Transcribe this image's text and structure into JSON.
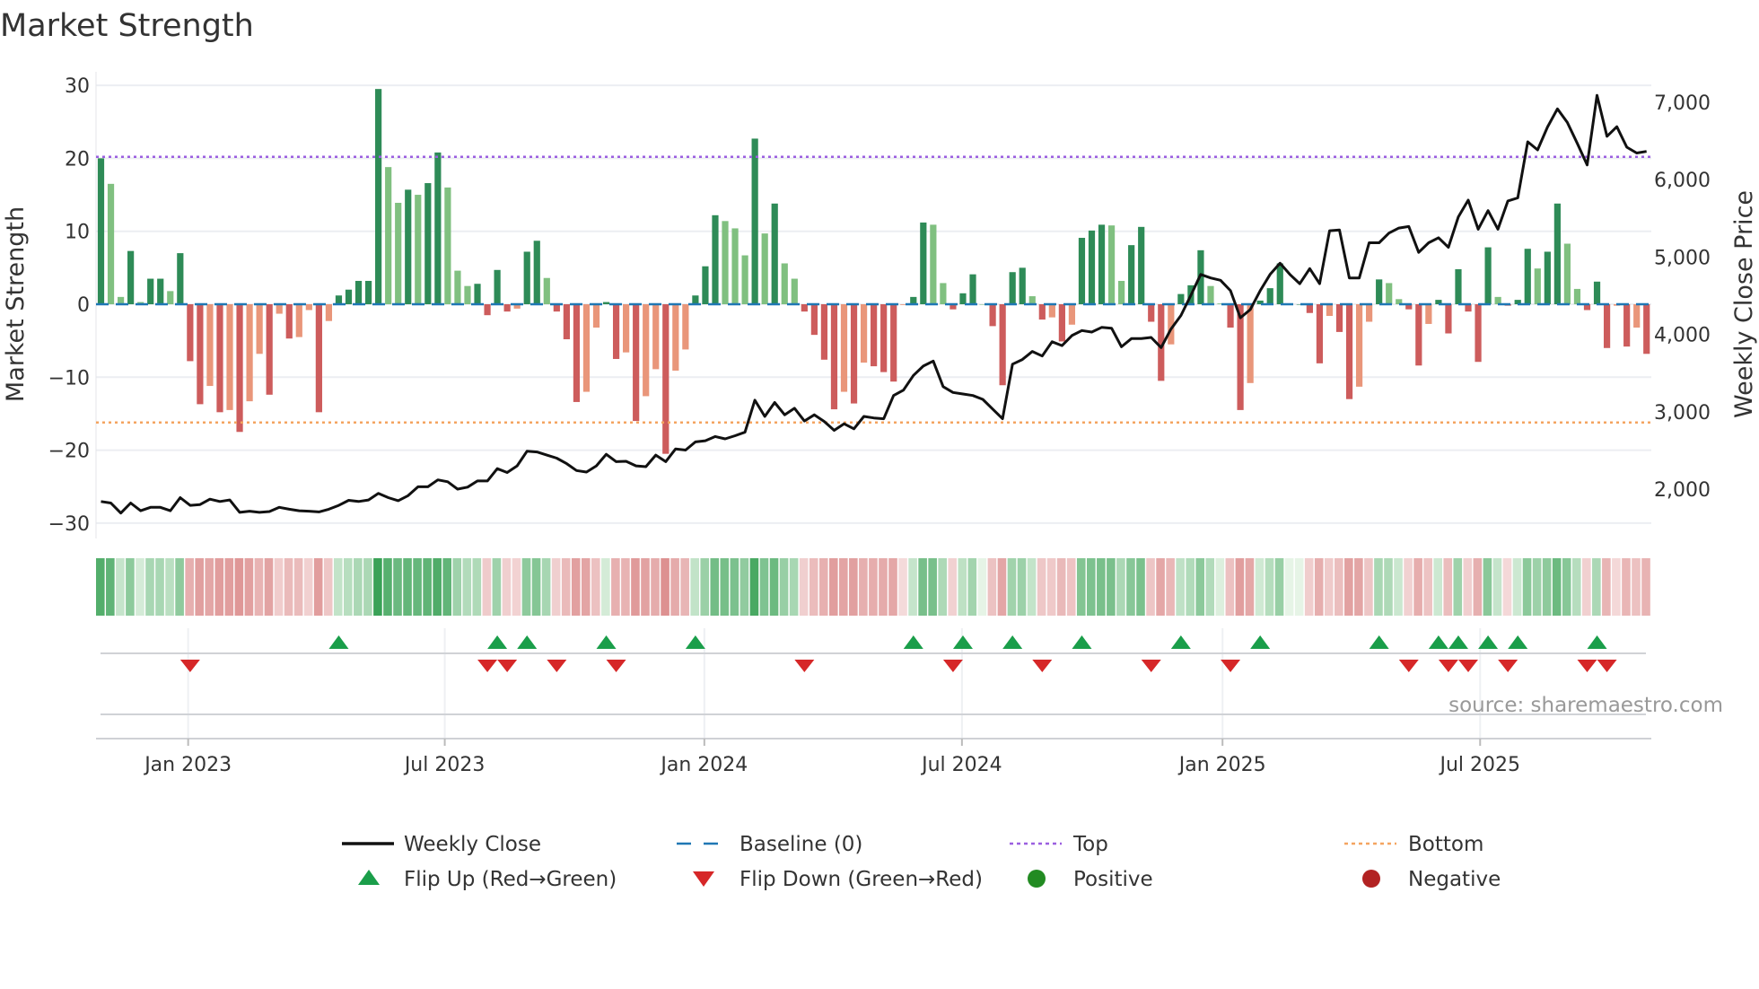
{
  "chart_data": {
    "type": "bar",
    "title": "Market Strength",
    "ylabel": "Market Strength",
    "y2label": "Weekly Close Price",
    "ylim": [
      -31,
      32
    ],
    "y2lim": [
      1500,
      7200
    ],
    "yticks": [
      30,
      20,
      10,
      0,
      -10,
      -20,
      -30
    ],
    "ytick_labels": [
      "30",
      "20",
      "10",
      "0",
      "−10",
      "−20",
      "−30"
    ],
    "y2ticks": [
      7000,
      6000,
      5000,
      4000,
      3000,
      2000
    ],
    "y2tick_labels": [
      "7,000",
      "6,000",
      "5,000",
      "4,000",
      "3,000",
      "2,000"
    ],
    "x_unit": "week index",
    "xticks": [
      {
        "label": "Jan 2023",
        "week": 8.8
      },
      {
        "label": "Jul 2023",
        "week": 34.7
      },
      {
        "label": "Jan 2024",
        "week": 60.9
      },
      {
        "label": "Jul 2024",
        "week": 86.9
      },
      {
        "label": "Jan 2025",
        "week": 113.2
      },
      {
        "label": "Jul 2025",
        "week": 139.2
      }
    ],
    "top_level": 20.2,
    "bottom_level": -16.2,
    "strength": [
      20,
      16.5,
      1,
      7.3,
      0.3,
      3.5,
      3.5,
      1.8,
      7,
      -7.8,
      -13.7,
      -11.2,
      -14.8,
      -14.5,
      -17.5,
      -13.3,
      -6.8,
      -12.4,
      -1.3,
      -4.7,
      -4.5,
      -0.8,
      -14.8,
      -2.3,
      1.2,
      2,
      3.2,
      3.2,
      29.5,
      18.8,
      13.9,
      15.7,
      15,
      16.6,
      20.8,
      16,
      4.6,
      2.5,
      2.8,
      -1.5,
      4.7,
      -1,
      -0.6,
      7.2,
      8.7,
      3.6,
      -1,
      -4.8,
      -13.4,
      -12,
      -3.2,
      0.3,
      -7.5,
      -6.6,
      -16,
      -12.6,
      -8.9,
      -20.5,
      -9.1,
      -6.2,
      1.2,
      5.2,
      12.2,
      11.4,
      10.4,
      6.7,
      22.7,
      9.7,
      13.8,
      5.6,
      3.5,
      -1,
      -4.2,
      -7.6,
      -14.4,
      -12,
      -13.6,
      -8,
      -8.5,
      -9.3,
      -10.6,
      -0.1,
      1,
      11.2,
      10.9,
      2.9,
      -0.7,
      1.5,
      4.1,
      0,
      -3,
      -11.1,
      4.4,
      5,
      1.1,
      -2.1,
      -1.8,
      -5.1,
      -2.8,
      9.1,
      10.1,
      10.9,
      10.8,
      3.2,
      8.1,
      10.6,
      -2.4,
      -10.5,
      -5.5,
      1.4,
      2.6,
      7.4,
      2.5,
      0.1,
      -3.2,
      -14.5,
      -10.8,
      0.5,
      2.2,
      5.6,
      0,
      0,
      -1.2,
      -8.1,
      -1.6,
      -3.8,
      -13,
      -11.3,
      -2.4,
      3.4,
      2.9,
      0.7,
      -0.7,
      -8.4,
      -2.7,
      0.6,
      -4,
      4.8,
      -1,
      -7.9,
      7.8,
      1,
      -0.2,
      0.6,
      7.6,
      4.9,
      7.2,
      13.8,
      8.3,
      2.1,
      -0.8,
      3.1,
      -6,
      -0.2,
      -5.8,
      -3.2,
      -6.8
    ],
    "weekly_close": [
      1840,
      1820,
      1690,
      1820,
      1720,
      1765,
      1765,
      1720,
      1890,
      1790,
      1800,
      1870,
      1840,
      1860,
      1700,
      1715,
      1700,
      1710,
      1765,
      1740,
      1720,
      1715,
      1705,
      1740,
      1790,
      1855,
      1840,
      1860,
      1945,
      1890,
      1850,
      1915,
      2030,
      2030,
      2120,
      2095,
      2000,
      2025,
      2105,
      2105,
      2265,
      2215,
      2300,
      2490,
      2480,
      2440,
      2400,
      2330,
      2240,
      2220,
      2300,
      2450,
      2355,
      2360,
      2300,
      2290,
      2440,
      2355,
      2520,
      2505,
      2610,
      2625,
      2680,
      2650,
      2690,
      2735,
      3150,
      2940,
      3120,
      2960,
      3045,
      2880,
      2960,
      2875,
      2760,
      2845,
      2780,
      2940,
      2920,
      2910,
      3210,
      3280,
      3470,
      3590,
      3655,
      3325,
      3250,
      3230,
      3210,
      3160,
      3035,
      2910,
      3615,
      3675,
      3780,
      3720,
      3905,
      3855,
      3985,
      4050,
      4030,
      4090,
      4080,
      3840,
      3945,
      3945,
      3960,
      3830,
      4070,
      4245,
      4505,
      4775,
      4730,
      4700,
      4565,
      4215,
      4320,
      4565,
      4775,
      4920,
      4775,
      4655,
      4850,
      4655,
      5340,
      5350,
      4730,
      4730,
      5185,
      5185,
      5310,
      5375,
      5395,
      5060,
      5185,
      5250,
      5125,
      5520,
      5735,
      5360,
      5600,
      5360,
      5725,
      5765,
      6490,
      6385,
      6680,
      6915,
      6740,
      6470,
      6190,
      7090,
      6560,
      6685,
      6420,
      6345,
      6365
    ],
    "legend": {
      "placement": "bottom",
      "items": [
        {
          "label": "Weekly Close",
          "kind": "line"
        },
        {
          "label": "Baseline (0)",
          "kind": "dash"
        },
        {
          "label": "Top",
          "kind": "dot-purple"
        },
        {
          "label": "Bottom",
          "kind": "dot-orange"
        },
        {
          "label": "Flip Up (Red→Green)",
          "kind": "tri-up"
        },
        {
          "label": "Flip Down (Green→Red)",
          "kind": "tri-down"
        },
        {
          "label": "Positive",
          "kind": "circle-green"
        },
        {
          "label": "Negative",
          "kind": "circle-red"
        }
      ]
    },
    "source": "source: sharemaestro.com",
    "colors": {
      "pos_rising": "#2e8b57",
      "pos_falling": "#80c080",
      "neg_falling": "#cd5c5c",
      "neg_rising": "#e9967a",
      "baseline": "#1f77b4",
      "top": "#9b5fe0",
      "bottom": "#f4a460",
      "close": "#111111",
      "flip_up": "#1a9e4a",
      "flip_down": "#d62728",
      "positive": "#228b22",
      "negative": "#b22222"
    }
  }
}
